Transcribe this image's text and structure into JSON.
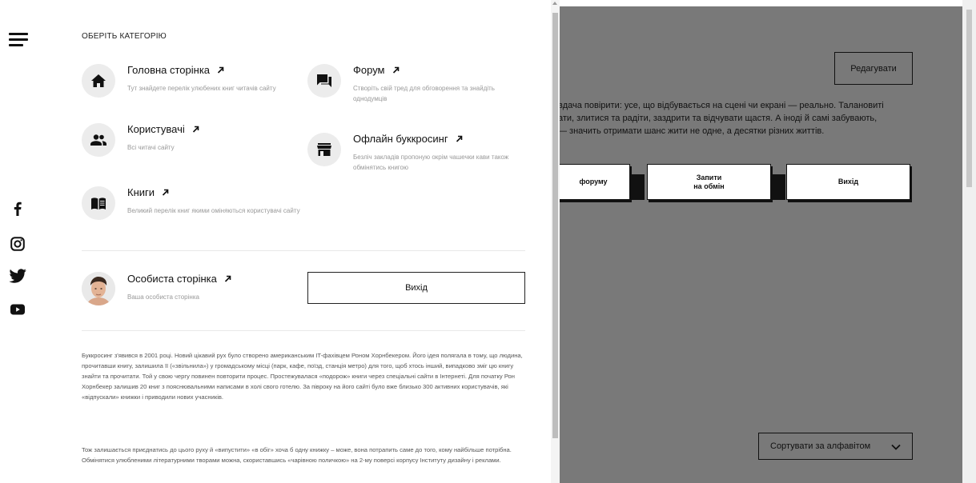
{
  "menu": {
    "heading": "ОБЕРІТЬ КАТЕГОРІЮ",
    "categories": [
      {
        "title": "Головна сторінка",
        "desc": "Тут знайдете перелік улюбених книг читачів сайту",
        "icon": "home-icon"
      },
      {
        "title": "Користувачі",
        "desc": "Всі читачі сайту",
        "icon": "users-icon"
      },
      {
        "title": "Книги",
        "desc": "Великий перелік книг якими оміняються користувачі сайту",
        "icon": "book-icon"
      },
      {
        "title": "Форум",
        "desc": "Створіть свій тред для обговорення та знайдіть однодумців",
        "icon": "forum-icon"
      },
      {
        "title": "Офлайн буккросинг",
        "desc": "Безліч закладів пропоную окрім чашечки кави також обмінятись книгою",
        "icon": "store-icon"
      }
    ],
    "profile": {
      "title": "Особиста сторінка",
      "desc": "Ваша особиста сторінка"
    },
    "logout_label": "Вихід",
    "about": [
      "Буккросинг з'явився в 2001 році. Новий цікавий рух було створено американським IT-фахівцем Роном Хорнбекером. Його ідея полягала в тому, що людина, прочитавши книгу, залишила її («звільнила») у громадському місці (парк, кафе, поїзд, станція метро) для того, щоб хтось інший, випадково зміг цю книгу знайти та прочитати. Той у свою чергу повинен повторити процес. Простежувалася «подорож» книги через спеціальні сайти в Інтернеті. Для початку Рон Хорнбекер залишив 20 книг з пояснювальними написами в холі свого готелю. За півроку на його сайті було вже близько 300 активних користувачів, які «відпускали» книжки і приводили нових учасників.",
      "Тож залишається приєднатись до цього руху й «випустити» «в обіг» хоча б одну книжку – може, вона потрапить саме до того, кому найбільше потрібна. Обмінятися улюбленими літературними творами можна, скориставшись «чарівною поличкою» на 2-му поверсі корпусу Інституту дизайну і реклами."
    ]
  },
  "social": [
    "facebook-icon",
    "instagram-icon",
    "twitter-icon",
    "youtube-icon"
  ],
  "background": {
    "edit_label": "Редагувати",
    "text_lines": [
      "вдача повірити: усе, що відбувається на сцені чи екрані — реально. Талановиті",
      "ати, злитися та радіти, заздрити та відчувати щастя. А іноді й самі забувають,",
      "— значить отримати шанс жити не одне, а десятки різних життів."
    ],
    "tabs": {
      "forum": "форуму",
      "requests_line1": "Запити",
      "requests_line2": "на обмін",
      "logout": "Вихід"
    },
    "sort_label": "Сортувати за алфавітом"
  },
  "colors": {
    "overlay": "#797979",
    "accent": "#111111"
  }
}
